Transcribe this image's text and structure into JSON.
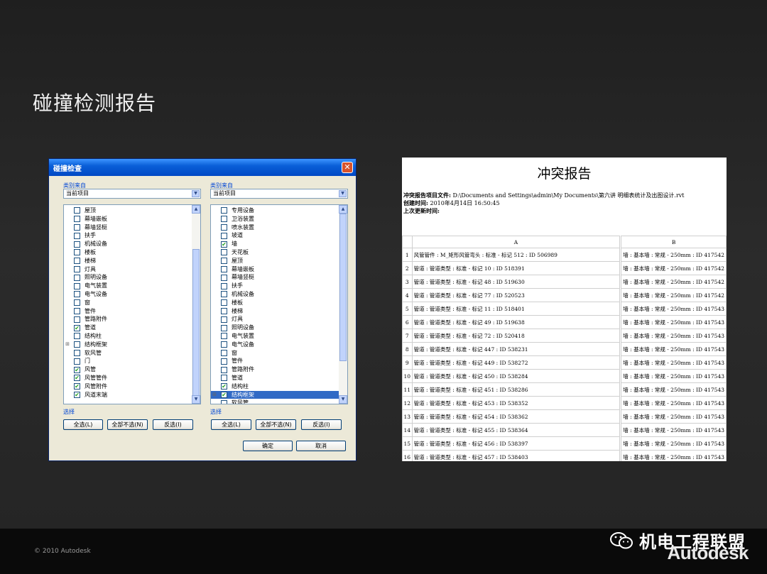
{
  "slide": {
    "title": "碰撞检测报告",
    "copyright": "© 2010 Autodesk",
    "brand_text": "机电工程联盟",
    "autodesk": "Autodesk"
  },
  "dialog": {
    "title": "碰撞检查",
    "close_symbol": "✕",
    "left": {
      "source_label": "类别来自",
      "source_value": "当前项目",
      "items": [
        {
          "label": "屋顶",
          "checked": false
        },
        {
          "label": "幕墙嵌板",
          "checked": false
        },
        {
          "label": "幕墙竖梃",
          "checked": false
        },
        {
          "label": "扶手",
          "checked": false
        },
        {
          "label": "机械设备",
          "checked": false
        },
        {
          "label": "楼板",
          "checked": false
        },
        {
          "label": "楼梯",
          "checked": false
        },
        {
          "label": "灯具",
          "checked": false
        },
        {
          "label": "照明设备",
          "checked": false
        },
        {
          "label": "电气装置",
          "checked": false
        },
        {
          "label": "电气设备",
          "checked": false
        },
        {
          "label": "窗",
          "checked": false
        },
        {
          "label": "管件",
          "checked": false
        },
        {
          "label": "管路附件",
          "checked": false
        },
        {
          "label": "管道",
          "checked": true
        },
        {
          "label": "结构柱",
          "checked": false
        },
        {
          "label": "结构框架",
          "checked": false,
          "expand": "⊞"
        },
        {
          "label": "软风管",
          "checked": false
        },
        {
          "label": "门",
          "checked": false
        },
        {
          "label": "风管",
          "checked": true
        },
        {
          "label": "风管管件",
          "checked": true
        },
        {
          "label": "风管附件",
          "checked": true
        },
        {
          "label": "风道末端",
          "checked": true
        }
      ]
    },
    "right": {
      "source_label": "类别来自",
      "source_value": "当前项目",
      "items": [
        {
          "label": "专用设备",
          "checked": false
        },
        {
          "label": "卫浴装置",
          "checked": false
        },
        {
          "label": "喷水装置",
          "checked": false
        },
        {
          "label": "坡道",
          "checked": false
        },
        {
          "label": "墙",
          "checked": true
        },
        {
          "label": "天花板",
          "checked": false
        },
        {
          "label": "屋顶",
          "checked": false
        },
        {
          "label": "幕墙嵌板",
          "checked": false
        },
        {
          "label": "幕墙竖梃",
          "checked": false
        },
        {
          "label": "扶手",
          "checked": false
        },
        {
          "label": "机械设备",
          "checked": false
        },
        {
          "label": "楼板",
          "checked": false
        },
        {
          "label": "楼梯",
          "checked": false
        },
        {
          "label": "灯具",
          "checked": false
        },
        {
          "label": "照明设备",
          "checked": false
        },
        {
          "label": "电气装置",
          "checked": false
        },
        {
          "label": "电气设备",
          "checked": false
        },
        {
          "label": "窗",
          "checked": false
        },
        {
          "label": "管件",
          "checked": false
        },
        {
          "label": "管路附件",
          "checked": false
        },
        {
          "label": "管道",
          "checked": false
        },
        {
          "label": "结构柱",
          "checked": true
        },
        {
          "label": "结构框架",
          "checked": true,
          "selected": true,
          "expand": "⊞"
        },
        {
          "label": "软风管",
          "checked": false
        }
      ]
    },
    "select_label": "选择",
    "btn_all": "全选(L)",
    "btn_none": "全部不选(N)",
    "btn_invert": "反选(I)",
    "btn_ok": "确定",
    "btn_cancel": "取消"
  },
  "report": {
    "title": "冲突报告",
    "file_label": "冲突报告项目文件:",
    "file_value": "D:\\Documents and Settings\\admin\\My Documents\\第六讲 明细表统计及出图设计.rvt",
    "created_label": "创建时间:",
    "created_value": "2010年4月14日 16:50:45",
    "updated_label": "上次更新时间:",
    "col_a": "A",
    "col_b": "B",
    "rows": [
      {
        "n": "1",
        "a": "风管管件 : M_矩形风管弯头 : 标准 - 标记 512 : ID 506989",
        "b": "墙 : 基本墙 : 常规 - 250mm : ID 417542"
      },
      {
        "n": "2",
        "a": "管道 : 管道类型 : 标准 - 标记 10 : ID 518391",
        "b": "墙 : 基本墙 : 常规 - 250mm : ID 417542"
      },
      {
        "n": "3",
        "a": "管道 : 管道类型 : 标准 - 标记 48 : ID 519630",
        "b": "墙 : 基本墙 : 常规 - 250mm : ID 417542"
      },
      {
        "n": "4",
        "a": "管道 : 管道类型 : 标准 - 标记 77 : ID 520523",
        "b": "墙 : 基本墙 : 常规 - 250mm : ID 417542"
      },
      {
        "n": "5",
        "a": "管道 : 管道类型 : 标准 - 标记 11 : ID 518401",
        "b": "墙 : 基本墙 : 常规 - 250mm : ID 417543"
      },
      {
        "n": "6",
        "a": "管道 : 管道类型 : 标准 - 标记 49 : ID 519638",
        "b": "墙 : 基本墙 : 常规 - 250mm : ID 417543"
      },
      {
        "n": "7",
        "a": "管道 : 管道类型 : 标准 - 标记 72 : ID 520418",
        "b": "墙 : 基本墙 : 常规 - 250mm : ID 417543"
      },
      {
        "n": "8",
        "a": "管道 : 管道类型 : 标准 - 标记 447 : ID 538231",
        "b": "墙 : 基本墙 : 常规 - 250mm : ID 417543"
      },
      {
        "n": "9",
        "a": "管道 : 管道类型 : 标准 - 标记 449 : ID 538272",
        "b": "墙 : 基本墙 : 常规 - 250mm : ID 417543"
      },
      {
        "n": "10",
        "a": "管道 : 管道类型 : 标准 - 标记 450 : ID 538284",
        "b": "墙 : 基本墙 : 常规 - 250mm : ID 417543"
      },
      {
        "n": "11",
        "a": "管道 : 管道类型 : 标准 - 标记 451 : ID 538286",
        "b": "墙 : 基本墙 : 常规 - 250mm : ID 417543"
      },
      {
        "n": "12",
        "a": "管道 : 管道类型 : 标准 - 标记 453 : ID 538352",
        "b": "墙 : 基本墙 : 常规 - 250mm : ID 417543"
      },
      {
        "n": "13",
        "a": "管道 : 管道类型 : 标准 - 标记 454 : ID 538362",
        "b": "墙 : 基本墙 : 常规 - 250mm : ID 417543"
      },
      {
        "n": "14",
        "a": "管道 : 管道类型 : 标准 - 标记 455 : ID 538364",
        "b": "墙 : 基本墙 : 常规 - 250mm : ID 417543"
      },
      {
        "n": "15",
        "a": "管道 : 管道类型 : 标准 - 标记 456 : ID 538397",
        "b": "墙 : 基本墙 : 常规 - 250mm : ID 417543"
      },
      {
        "n": "16",
        "a": "管道 : 管道类型 : 标准 - 标记 457 : ID 538403",
        "b": "墙 : 基本墙 : 常规 - 250mm : ID 417543"
      }
    ]
  },
  "icons": {
    "check": "✔",
    "down": "▼",
    "up": "▲",
    "wechat": "wechat-icon"
  }
}
